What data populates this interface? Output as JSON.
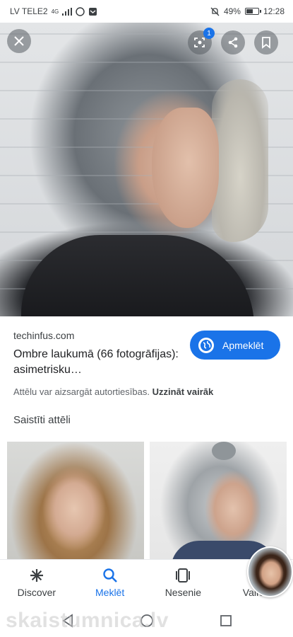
{
  "status_bar": {
    "carrier": "LV TELE2",
    "network": "4G",
    "battery_percent": "49%",
    "battery_level": 0.49,
    "time": "12:28"
  },
  "hero": {
    "lens_badge_count": "1",
    "icons": [
      "close-icon",
      "lens-icon",
      "share-icon",
      "bookmark-icon"
    ]
  },
  "source": {
    "domain": "techinfus.com",
    "title": "Ombre laukumā (66 fotogrāfijas): asimetrisku…",
    "visit_label": "Apmeklēt",
    "copyright_text": "Attēlu var aizsargāt autortiesības.",
    "learn_more": "Uzzināt vairāk"
  },
  "related": {
    "title": "Saistīti attēli"
  },
  "bottom_nav": {
    "items": [
      {
        "label": "Discover",
        "icon": "asterisk-icon"
      },
      {
        "label": "Meklēt",
        "icon": "search-icon",
        "active": true
      },
      {
        "label": "Nesenie",
        "icon": "recent-icon"
      },
      {
        "label": "Vairāk",
        "icon": "more-icon"
      }
    ]
  },
  "watermark": "skaistumnica.lv",
  "colors": {
    "accent": "#1a73e8",
    "text": "#202124",
    "muted": "#5f6368"
  }
}
